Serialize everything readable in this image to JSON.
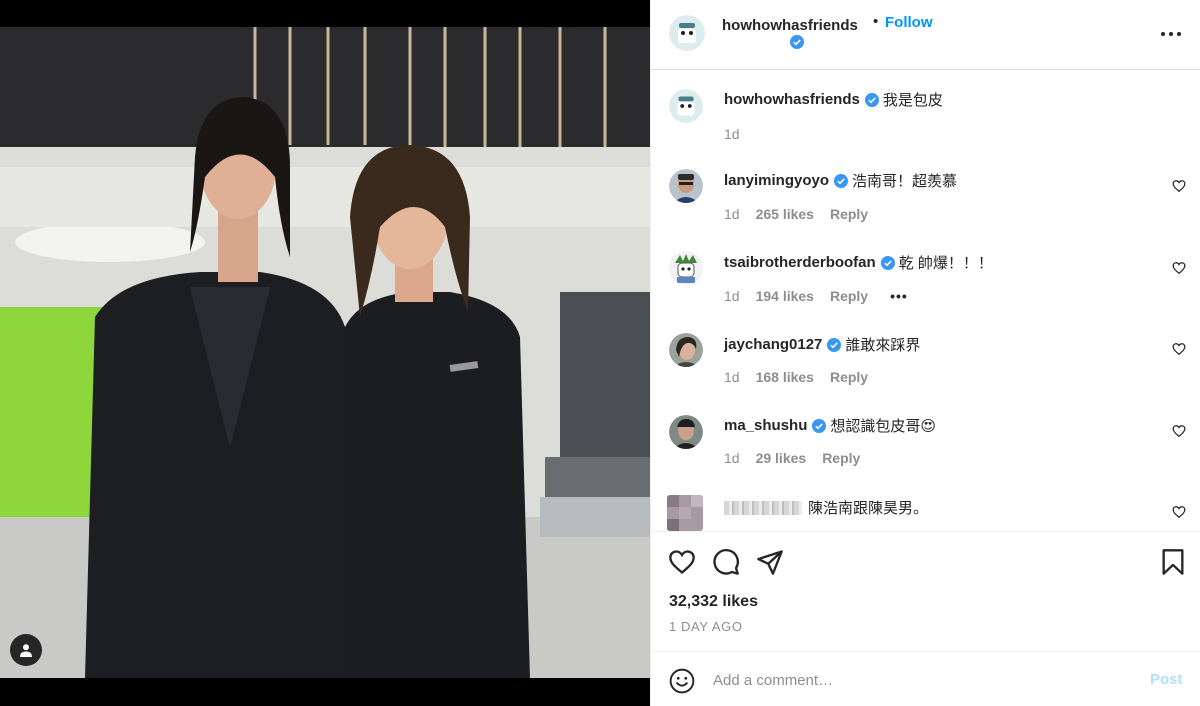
{
  "post": {
    "username": "howhowhasfriends",
    "follow_label": "Follow",
    "separator": "•",
    "icons": {
      "verified": "verified-badge-icon",
      "more": "more-options-icon",
      "tag": "user-tag-icon"
    },
    "accent_color": "#0095f6"
  },
  "caption": {
    "username": "howhowhasfriends",
    "text": "我是包皮",
    "time": "1d"
  },
  "comments": [
    {
      "username": "lanyimingyoyo",
      "text": "浩南哥！超羨慕",
      "time": "1d",
      "likes": "265 likes",
      "reply": "Reply"
    },
    {
      "username": "tsaibrotherderboofan",
      "text": "乾 帥爆！！！",
      "time": "1d",
      "likes": "194 likes",
      "reply": "Reply",
      "more": "•••"
    },
    {
      "username": "jaychang0127",
      "text": "誰敢來踩界",
      "time": "1d",
      "likes": "168 likes",
      "reply": "Reply"
    },
    {
      "username": "ma_shushu",
      "text": "想認識包皮哥😍",
      "time": "1d",
      "likes": "29 likes",
      "reply": "Reply"
    },
    {
      "text": "陳浩南跟陳昊男。"
    }
  ],
  "actions": {
    "icons": [
      "heart-icon",
      "comment-icon",
      "share-icon",
      "bookmark-icon"
    ],
    "likes": "32,332 likes",
    "time_ago": "1 DAY AGO"
  },
  "composer": {
    "placeholder": "Add a comment…",
    "post_label": "Post",
    "post_color": "#b2dffc"
  }
}
